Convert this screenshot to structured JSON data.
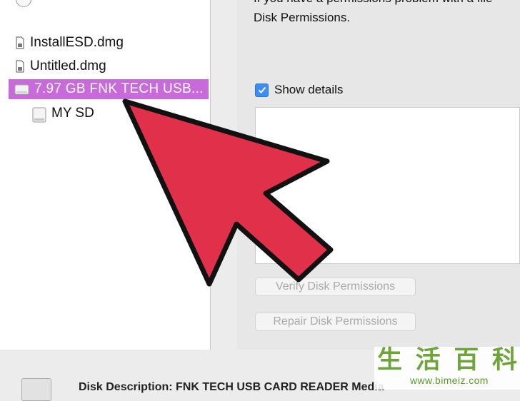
{
  "sidebar": {
    "items": [
      {
        "label": "InstallESD.dmg",
        "icon": "disk-image-file-icon"
      },
      {
        "label": "Untitled.dmg",
        "icon": "disk-image-file-icon"
      },
      {
        "label": "7.97 GB FNK TECH USB...",
        "icon": "external-drive-icon",
        "selected": true
      },
      {
        "label": "MY SD",
        "icon": "volume-drive-icon"
      }
    ]
  },
  "main": {
    "help_line_1": "If you have a permissions problem with a file",
    "help_line_2": "Disk Permissions.",
    "show_details_label": "Show details",
    "show_details_checked": true,
    "verify_button": "Verify Disk Permissions",
    "repair_button": "Repair Disk Permissions"
  },
  "bottom": {
    "text": "Disk Description: FNK TECH USB CARD READER Media"
  },
  "watermark": {
    "chars": [
      "生",
      "活",
      "百",
      "科"
    ],
    "url": "www.bimeiz.com"
  },
  "colors": {
    "selection": "#c86ad9",
    "checkbox": "#3b8ff3",
    "arrow_fill": "#e0304a",
    "watermark": "#6da53a"
  }
}
